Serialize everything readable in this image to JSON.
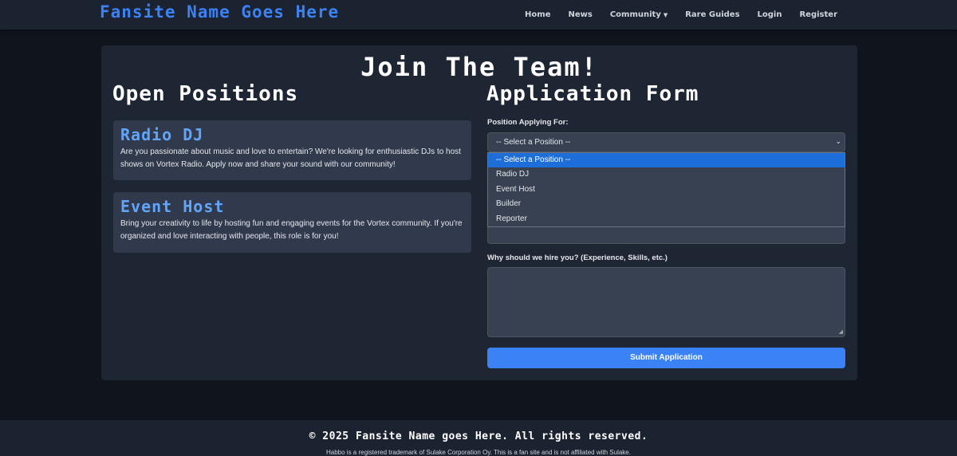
{
  "brand": "Fansite Name Goes Here",
  "nav": {
    "home": "Home",
    "news": "News",
    "community": "Community",
    "rare_guides": "Rare Guides",
    "login": "Login",
    "register": "Register"
  },
  "page_title": "Join The Team!",
  "open_positions": {
    "heading": "Open Positions",
    "positions": [
      {
        "title": "Radio DJ",
        "description": "Are you passionate about music and love to entertain? We're looking for enthusiastic DJs to host shows on Vortex Radio. Apply now and share your sound with our community!"
      },
      {
        "title": "Event Host",
        "description": "Bring your creativity to life by hosting fun and engaging events for the Vortex community. If you're organized and love interacting with people, this role is for you!"
      }
    ]
  },
  "form": {
    "heading": "Application Form",
    "position_label": "Position Applying For:",
    "position_selected": "-- Select a Position --",
    "position_options": [
      "-- Select a Position --",
      "Radio DJ",
      "Event Host",
      "Builder",
      "Reporter"
    ],
    "why_label": "Why should we hire you? (Experience, Skills, etc.)",
    "submit_label": "Submit Application"
  },
  "footer": {
    "copyright": "© 2025 Fansite Name goes Here. All rights reserved.",
    "note": "Habbo is a registered trademark of Sulake Corporation Oy. This is a fan site and is not affiliated with Sulake."
  },
  "colors": {
    "accent": "#3b82f6",
    "selected_option": "#1d6ed8",
    "card_bg": "#1e2533",
    "position_card_bg": "#313a4c"
  }
}
